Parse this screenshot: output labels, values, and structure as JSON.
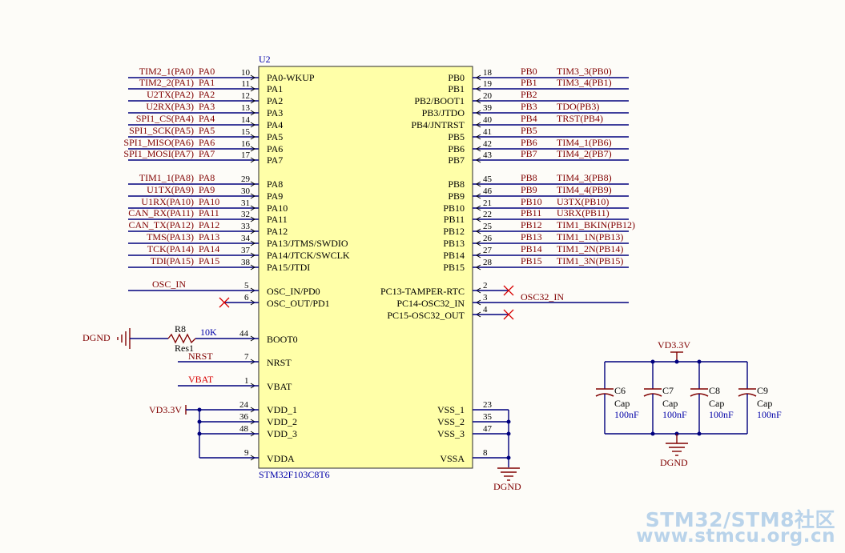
{
  "colors": {
    "background": "#fdfcf8",
    "chip_fill": "#ffffa8",
    "chip_border": "#2a2a2a",
    "wire": "#00007e",
    "net_label": "#800000",
    "designator": "#0000a8",
    "pin_number": "#000000",
    "no_connect": "#d80000",
    "watermark": "#b9d3ea"
  },
  "chip": {
    "designator": "U2",
    "part": "STM32F103C8T6"
  },
  "left_pins": [
    {
      "net": "TIM2_1(PA0)",
      "pin": "PA0",
      "num": "10",
      "name": "PA0-WKUP"
    },
    {
      "net": "TIM2_2(PA1)",
      "pin": "PA1",
      "num": "11",
      "name": "PA1"
    },
    {
      "net": "U2TX(PA2)",
      "pin": "PA2",
      "num": "12",
      "name": "PA2"
    },
    {
      "net": "U2RX(PA3)",
      "pin": "PA3",
      "num": "13",
      "name": "PA3"
    },
    {
      "net": "SPI1_CS(PA4)",
      "pin": "PA4",
      "num": "14",
      "name": "PA4"
    },
    {
      "net": "SPI1_SCK(PA5)",
      "pin": "PA5",
      "num": "15",
      "name": "PA5"
    },
    {
      "net": "SPI1_MISO(PA6)",
      "pin": "PA6",
      "num": "16",
      "name": "PA6"
    },
    {
      "net": "SPI1_MOSI(PA7)",
      "pin": "PA7",
      "num": "17",
      "name": "PA7"
    },
    {
      "net": "TIM1_1(PA8)",
      "pin": "PA8",
      "num": "29",
      "name": "PA8"
    },
    {
      "net": "U1TX(PA9)",
      "pin": "PA9",
      "num": "30",
      "name": "PA9"
    },
    {
      "net": "U1RX(PA10)",
      "pin": "PA10",
      "num": "31",
      "name": "PA10"
    },
    {
      "net": "CAN_RX(PA11)",
      "pin": "PA11",
      "num": "32",
      "name": "PA11"
    },
    {
      "net": "CAN_TX(PA12)",
      "pin": "PA12",
      "num": "33",
      "name": "PA12"
    },
    {
      "net": "TMS(PA13)",
      "pin": "PA13",
      "num": "34",
      "name": "PA13/JTMS/SWDIO"
    },
    {
      "net": "TCK(PA14)",
      "pin": "PA14",
      "num": "37",
      "name": "PA14/JTCK/SWCLK"
    },
    {
      "net": "TDI(PA15)",
      "pin": "PA15",
      "num": "38",
      "name": "PA15/JTDI"
    }
  ],
  "right_pins": [
    {
      "name": "PB0",
      "num": "18",
      "pin": "PB0",
      "net": "TIM3_3(PB0)"
    },
    {
      "name": "PB1",
      "num": "19",
      "pin": "PB1",
      "net": "TIM3_4(PB1)"
    },
    {
      "name": "PB2/BOOT1",
      "num": "20",
      "pin": "PB2",
      "net": ""
    },
    {
      "name": "PB3/JTDO",
      "num": "39",
      "pin": "PB3",
      "net": "TDO(PB3)"
    },
    {
      "name": "PB4/JNTRST",
      "num": "40",
      "pin": "PB4",
      "net": "TRST(PB4)"
    },
    {
      "name": "PB5",
      "num": "41",
      "pin": "PB5",
      "net": ""
    },
    {
      "name": "PB6",
      "num": "42",
      "pin": "PB6",
      "net": "TIM4_1(PB6)"
    },
    {
      "name": "PB7",
      "num": "43",
      "pin": "PB7",
      "net": "TIM4_2(PB7)"
    },
    {
      "name": "PB8",
      "num": "45",
      "pin": "PB8",
      "net": "TIM4_3(PB8)"
    },
    {
      "name": "PB9",
      "num": "46",
      "pin": "PB9",
      "net": "TIM4_4(PB9)"
    },
    {
      "name": "PB10",
      "num": "21",
      "pin": "PB10",
      "net": "U3TX(PB10)"
    },
    {
      "name": "PB11",
      "num": "22",
      "pin": "PB11",
      "net": "U3RX(PB11)"
    },
    {
      "name": "PB12",
      "num": "25",
      "pin": "PB12",
      "net": "TIM1_BKIN(PB12)"
    },
    {
      "name": "PB13",
      "num": "26",
      "pin": "PB13",
      "net": "TIM1_1N(PB13)"
    },
    {
      "name": "PB14",
      "num": "27",
      "pin": "PB14",
      "net": "TIM1_2N(PB14)"
    },
    {
      "name": "PB15",
      "num": "28",
      "pin": "PB15",
      "net": "TIM1_3N(PB15)"
    }
  ],
  "osc": {
    "in": {
      "net": "OSC_IN",
      "num": "5",
      "name": "OSC_IN/PD0"
    },
    "out": {
      "num": "6",
      "name": "OSC_OUT/PD1"
    },
    "pc13": {
      "name": "PC13-TAMPER-RTC",
      "num": "2"
    },
    "pc14": {
      "name": "PC14-OSC32_IN",
      "num": "3",
      "net": "OSC32_IN"
    },
    "pc15": {
      "name": "PC15-OSC32_OUT",
      "num": "4"
    }
  },
  "boot": {
    "ground": "DGND",
    "resistor": "R8",
    "value": "10K",
    "part": "Res1",
    "num": "44",
    "name": "BOOT0"
  },
  "nrst": {
    "net": "NRST",
    "num": "7",
    "name": "NRST"
  },
  "vbat": {
    "net": "VBAT",
    "num": "1",
    "name": "VBAT"
  },
  "power_in": {
    "label": "VD3.3V",
    "pins": [
      {
        "num": "24",
        "name": "VDD_1"
      },
      {
        "num": "36",
        "name": "VDD_2"
      },
      {
        "num": "48",
        "name": "VDD_3"
      },
      {
        "num": "9",
        "name": "VDDA"
      }
    ]
  },
  "ground_out": {
    "label": "DGND",
    "pins": [
      {
        "num": "23",
        "name": "VSS_1"
      },
      {
        "num": "35",
        "name": "VSS_2"
      },
      {
        "num": "47",
        "name": "VSS_3"
      },
      {
        "num": "8",
        "name": "VSSA"
      }
    ]
  },
  "decoupling": {
    "power": "VD3.3V",
    "ground": "DGND",
    "caps": [
      {
        "ref": "C6",
        "type": "Cap",
        "value": "100nF"
      },
      {
        "ref": "C7",
        "type": "Cap",
        "value": "100nF"
      },
      {
        "ref": "C8",
        "type": "Cap",
        "value": "100nF"
      },
      {
        "ref": "C9",
        "type": "Cap",
        "value": "100nF"
      }
    ]
  },
  "watermark": {
    "line1": "STM32/STM8社区",
    "line2": "www.stmcu.org.cn"
  }
}
